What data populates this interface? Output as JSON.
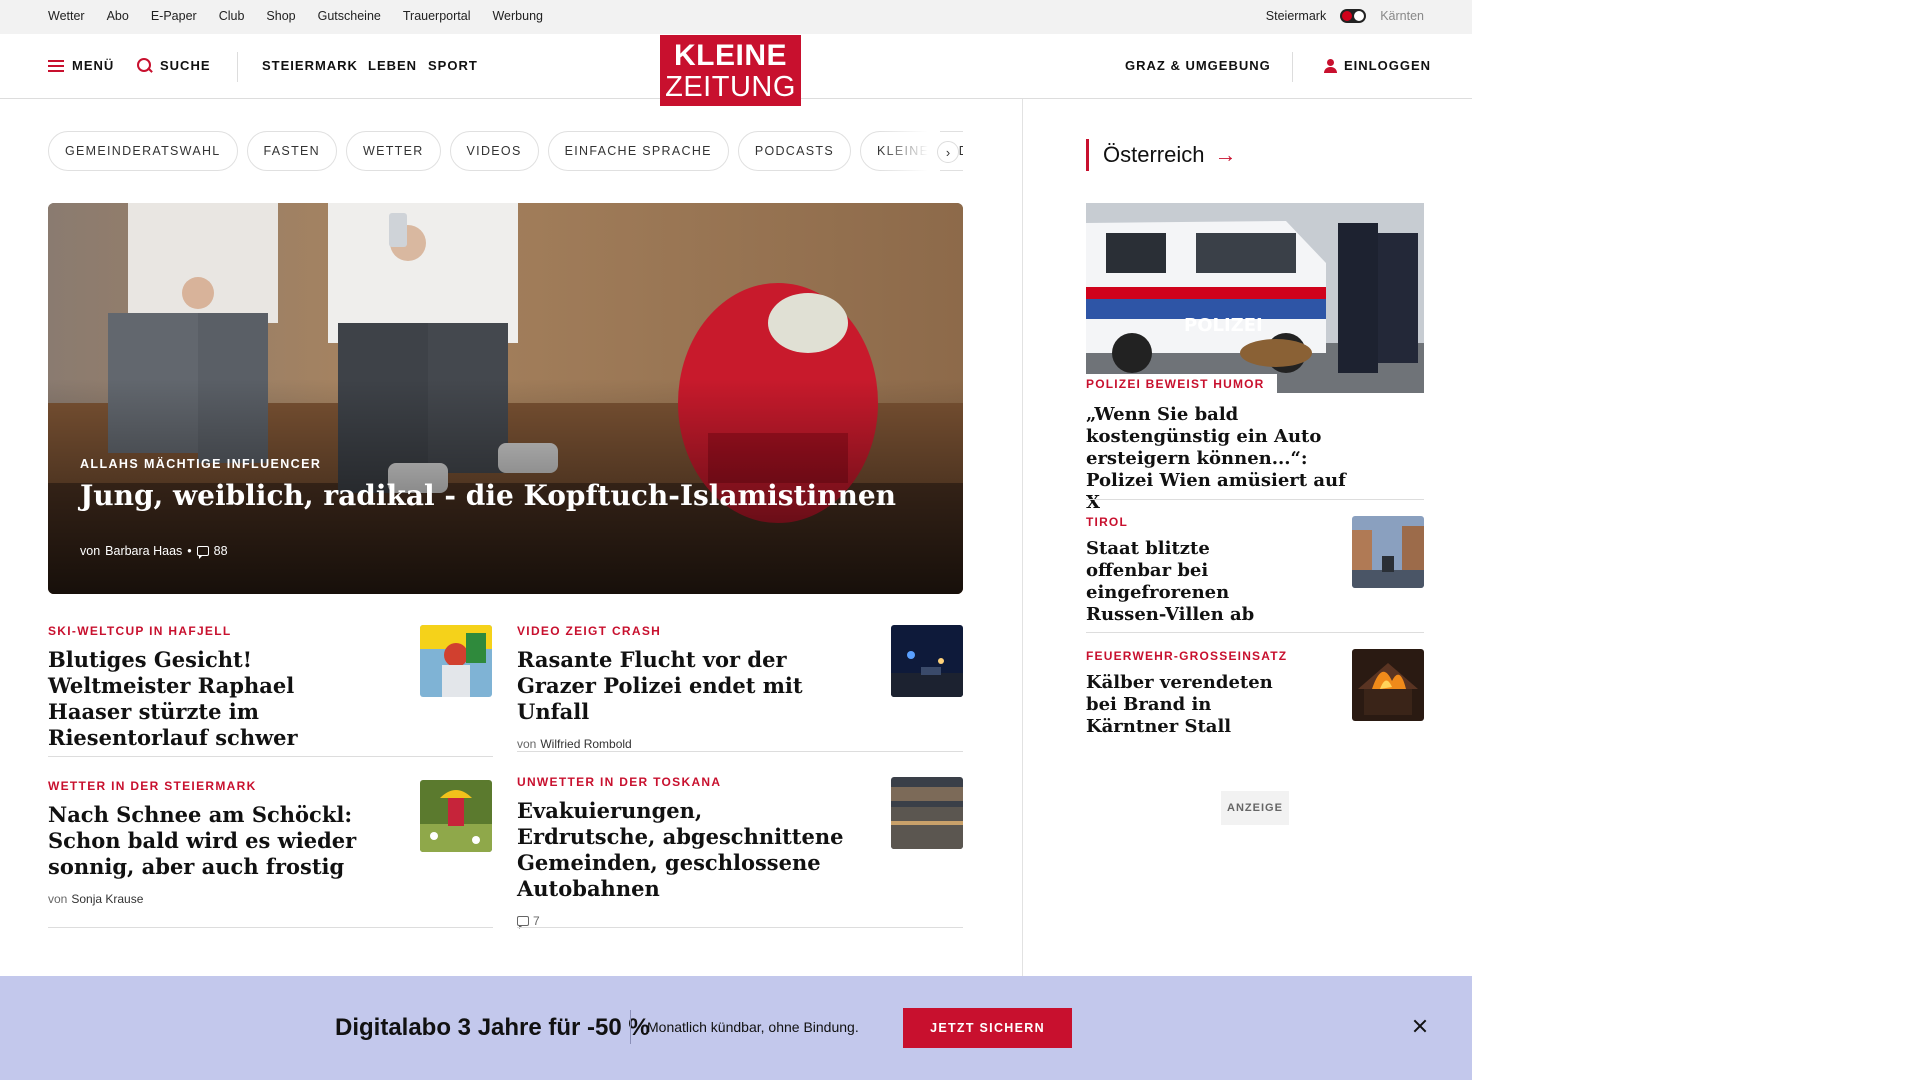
{
  "utility_bar": {
    "links": [
      "Wetter",
      "Abo",
      "E-Paper",
      "Club",
      "Shop",
      "Gutscheine",
      "Trauerportal",
      "Werbung"
    ],
    "region_active": "Steiermark",
    "region_inactive": "Kärnten"
  },
  "nav": {
    "menu_label": "MENÜ",
    "search_label": "SUCHE",
    "sections": [
      "STEIERMARK",
      "LEBEN",
      "SPORT"
    ],
    "logo_line1": "KLEINE",
    "logo_line2": "ZEITUNG",
    "region_link": "GRAZ & UMGEBUNG",
    "login_label": "EINLOGGEN"
  },
  "topics": [
    "GEMEINDERATSWAHL",
    "FASTEN",
    "WETTER",
    "VIDEOS",
    "EINFACHE SPRACHE",
    "PODCASTS",
    "KLEINE KINDER"
  ],
  "topics_next": "›",
  "hero": {
    "kicker": "ALLAHS MÄCHTIGE INFLUENCER",
    "headline": "Jung, weiblich, radikal - die Kopftuch-Islamistinnen",
    "byline_prefix": "von",
    "author": "Barbara Haas",
    "separator": "•",
    "comments": "88"
  },
  "articles": [
    {
      "kicker": "SKI-WELTCUP IN HAFJELL",
      "title": "Blutiges Gesicht! Weltmeister Raphael Haaser stürzte im Riesentorlauf schwer",
      "byline_prefix": "",
      "author": "",
      "comments": ""
    },
    {
      "kicker": "VIDEO ZEIGT CRASH",
      "title": "Rasante Flucht vor der Grazer Polizei endet mit Unfall",
      "byline_prefix": "von",
      "author": "Wilfried Rombold",
      "comments": ""
    },
    {
      "kicker": "WETTER IN DER STEIERMARK",
      "title": "Nach Schnee am Schöckl: Schon bald wird es wieder sonnig, aber auch frostig",
      "byline_prefix": "von",
      "author": "Sonja Krause",
      "comments": ""
    },
    {
      "kicker": "UNWETTER IN DER TOSKANA",
      "title": "Evakuierungen, Erdrutsche, abgeschnittene Gemeinden, geschlossene Autobahnen",
      "byline_prefix": "",
      "author": "",
      "comments": "7"
    }
  ],
  "sidebar": {
    "heading": "Österreich",
    "heading_arrow": "→",
    "hero_kicker": "POLIZEI BEWEIST HUMOR",
    "hero_title": "„Wenn Sie bald kostengünstig ein Auto ersteigern können...“: Polizei Wien amüsiert auf X",
    "hero_image_text": "POLIZEI",
    "items": [
      {
        "kicker": "TIROL",
        "title": "Staat blitzte offenbar bei eingefrorenen Russen-Villen ab"
      },
      {
        "kicker": "FEUERWEHR-GROSSEINSATZ",
        "title": "Kälber verendeten bei Brand in Kärntner Stall"
      }
    ],
    "ad_label": "ANZEIGE"
  },
  "promo": {
    "headline": "Digitalabo 3 Jahre für -50 %",
    "subtext": "Monatlich kündbar, ohne Bindung.",
    "cta": "JETZT SICHERN"
  },
  "colors": {
    "brand_red": "#c8102e",
    "promo_bg": "#c3c8ec",
    "utility_bg": "#f2f2f2"
  }
}
